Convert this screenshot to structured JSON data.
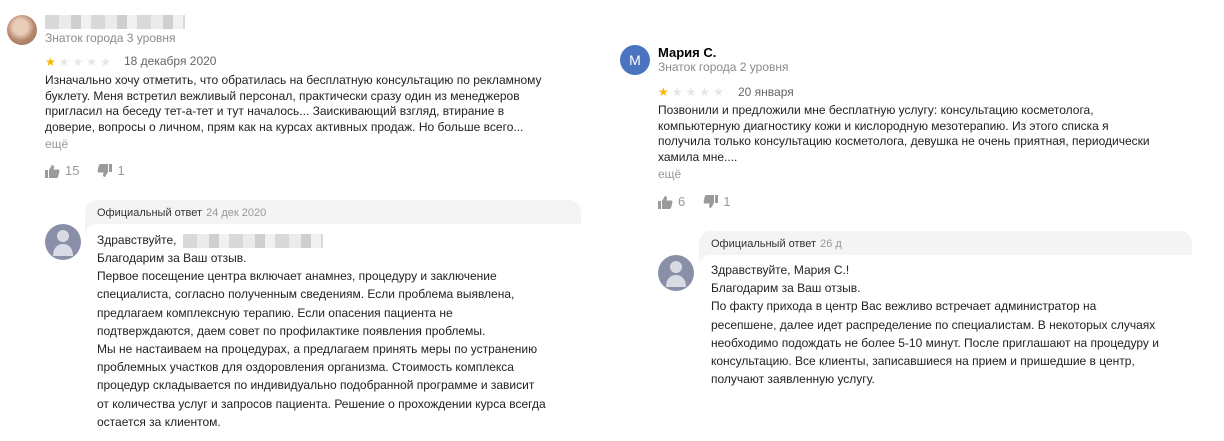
{
  "reviews": [
    {
      "author_level": "Знаток города 3 уровня",
      "rating": 1,
      "date": "18 декабря 2020",
      "text": "Изначально хочу отметить, что обратилась на бесплатную консультацию по рекламному\nбуклету. Меня встретил вежливый персонал, практически сразу один из менеджеров\nпригласил на беседу тет-а-тет и тут началось... Заискивающий взгляд, втирание в\nдоверие, вопросы о личном, прям как на курсах активных продаж. Но больше всего...",
      "more": "ещё",
      "likes": "15",
      "dislikes": "1",
      "reply": {
        "label": "Официальный ответ",
        "date": "24 дек 2020",
        "greeting": "Здравствуйте,",
        "text": "Благодарим за Ваш отзыв.\nПервое посещение центра включает анамнез, процедуру и заключение\nспециалиста, согласно полученным сведениям. Если проблема выявлена,\nпредлагаем комплексную терапию. Если опасения пациента не\nподтверждаются, даем совет по профилактике появления проблемы.\nМы не настаиваем на процедурах, а предлагаем принять меры по устранению\nпроблемных участков для оздоровления организма. Стоимость комплекса\nпроцедур складывается по индивидуально подобранной программе и зависит\nот количества услуг и запросов пациента. Решение о прохождении курса всегда\nостается за клиентом."
      }
    },
    {
      "author_initial": "М",
      "author_name": "Мария С.",
      "author_level": "Знаток города 2 уровня",
      "rating": 1,
      "date": "20 января",
      "text": "Позвонили и предложили мне бесплатную услугу: консультацию косметолога,\nкомпьютерную диагностику кожи и кислородную мезотерапию. Из этого списка я\nполучила только консультацию косметолога, девушка не очень приятная, периодически\nхамила мне....",
      "more": "ещё",
      "likes": "6",
      "dislikes": "1",
      "reply": {
        "label": "Официальный ответ",
        "date": "26 д",
        "text": "Здравствуйте, Мария С.!\nБлагодарим за Ваш отзыв.\nПо факту прихода в центр Вас вежливо встречает администратор на\nресепшене, далее идет распределение по специалистам. В некоторых случаях\nнеобходимо подождать не более 5-10 минут. После приглашают на процедуру и\nконсультацию. Все клиенты, записавшиеся на прием и пришедшие в центр,\nполучают заявленную услугу."
      }
    }
  ],
  "colors": {
    "star_filled": "#f9b704",
    "star_empty": "#e6e6e6",
    "initial_avatar": "#4a73c0",
    "reply_bg": "#f4f4f4"
  },
  "icons": [
    "thumbs-up-icon",
    "thumbs-down-icon",
    "org-avatar-icon",
    "star-icon"
  ]
}
